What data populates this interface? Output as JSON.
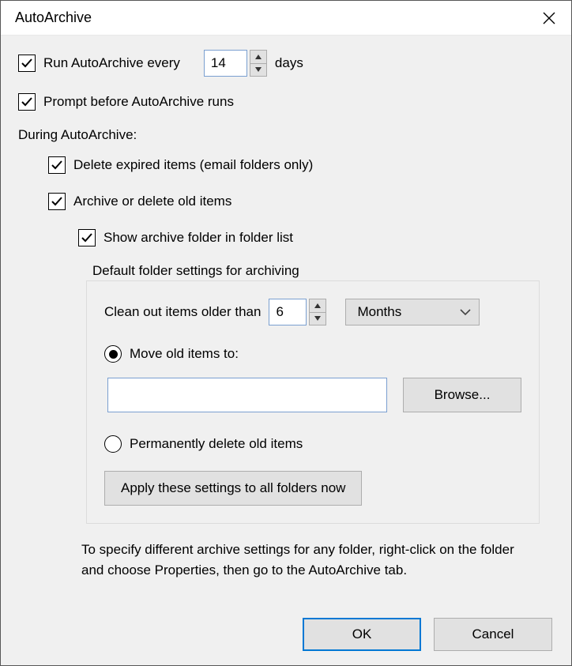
{
  "window": {
    "title": "AutoArchive"
  },
  "run": {
    "label_prefix": "Run AutoArchive every",
    "value": "14",
    "label_suffix": "days"
  },
  "prompt_label": "Prompt before AutoArchive runs",
  "during_label": "During AutoArchive:",
  "delete_expired_label": "Delete expired items (email folders only)",
  "archive_old_label": "Archive or delete old items",
  "show_folder_label": "Show archive folder in folder list",
  "fieldset": {
    "title": "Default folder settings for archiving",
    "clean_prefix": "Clean out items older than",
    "clean_value": "6",
    "unit_selected": "Months",
    "move_label": "Move old items to:",
    "move_path": "",
    "browse_label": "Browse...",
    "perm_delete_label": "Permanently delete old items",
    "apply_label": "Apply these settings to all folders now"
  },
  "hint": "To specify different archive settings for any folder, right-click on the folder and choose Properties, then go to the AutoArchive tab.",
  "buttons": {
    "ok": "OK",
    "cancel": "Cancel"
  }
}
